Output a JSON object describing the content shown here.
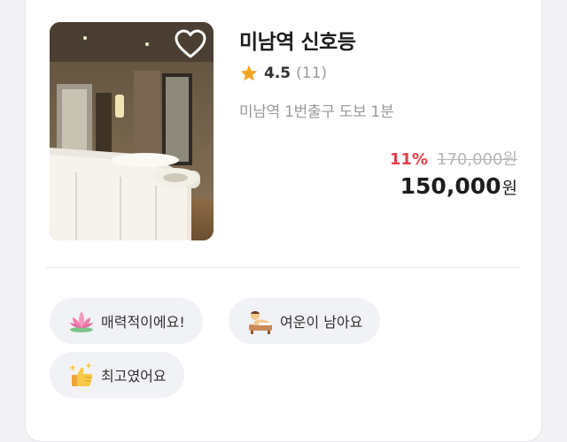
{
  "card": {
    "title": "미남역 신호등",
    "rating": "4.5",
    "review_count": "(11)",
    "location": "미남역 1번출구 도보 1분",
    "discount": "11%",
    "original_price": "170,000원",
    "price": "150,000",
    "price_unit": "원",
    "favorite_icon": "heart-outline-icon",
    "rating_icon": "star-icon",
    "colors": {
      "discount": "#e5404b",
      "star": "#f5a623",
      "tag_bg": "#f1f2f5"
    }
  },
  "tags": [
    {
      "label": "매력적이에요!",
      "icon": "lotus-icon"
    },
    {
      "label": "여운이 남아요",
      "icon": "massage-icon"
    },
    {
      "label": "최고였어요",
      "icon": "thumbs-up-icon"
    }
  ]
}
